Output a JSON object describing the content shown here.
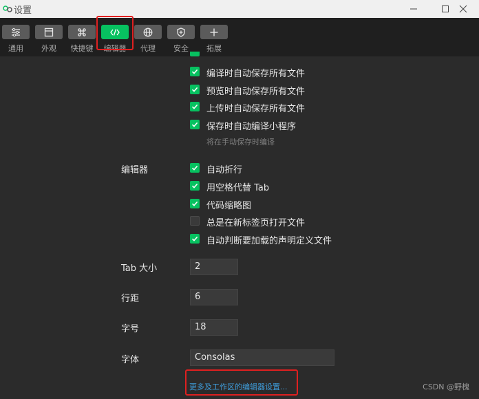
{
  "window": {
    "title": "设置"
  },
  "toolbar": {
    "items": [
      {
        "label": "通用",
        "icon": "sliders-icon"
      },
      {
        "label": "外观",
        "icon": "window-icon"
      },
      {
        "label": "快捷键",
        "icon": "command-key-icon"
      },
      {
        "label": "编辑器",
        "icon": "code-icon"
      },
      {
        "label": "代理",
        "icon": "globe-icon"
      },
      {
        "label": "安全",
        "icon": "shield-icon"
      },
      {
        "label": "拓展",
        "icon": "plus-icon"
      }
    ],
    "active": "编辑器"
  },
  "save_section": {
    "options": [
      {
        "label": "编译时自动保存所有文件",
        "checked": true
      },
      {
        "label": "预览时自动保存所有文件",
        "checked": true
      },
      {
        "label": "上传时自动保存所有文件",
        "checked": true
      },
      {
        "label": "保存时自动编译小程序",
        "checked": true
      }
    ],
    "hint": "将在手动保存时编译"
  },
  "editor_section": {
    "label": "编辑器",
    "options": [
      {
        "label": "自动折行",
        "checked": true
      },
      {
        "label": "用空格代替 Tab",
        "checked": true
      },
      {
        "label": "代码缩略图",
        "checked": true
      },
      {
        "label": "总是在新标签页打开文件",
        "checked": false
      },
      {
        "label": "自动判断要加载的声明定义文件",
        "checked": true
      }
    ]
  },
  "fields": {
    "tab_size": {
      "label": "Tab 大小",
      "value": "2"
    },
    "line_height": {
      "label": "行距",
      "value": "6"
    },
    "font_size": {
      "label": "字号",
      "value": "18"
    },
    "font_family": {
      "label": "字体",
      "value": "Consolas"
    }
  },
  "more_link": "更多及工作区的编辑器设置...",
  "watermark": "CSDN @野槐",
  "colors": {
    "accent": "#07c160",
    "highlight": "#e02020",
    "link": "#3e9bd8",
    "background": "#2b2b2b"
  }
}
